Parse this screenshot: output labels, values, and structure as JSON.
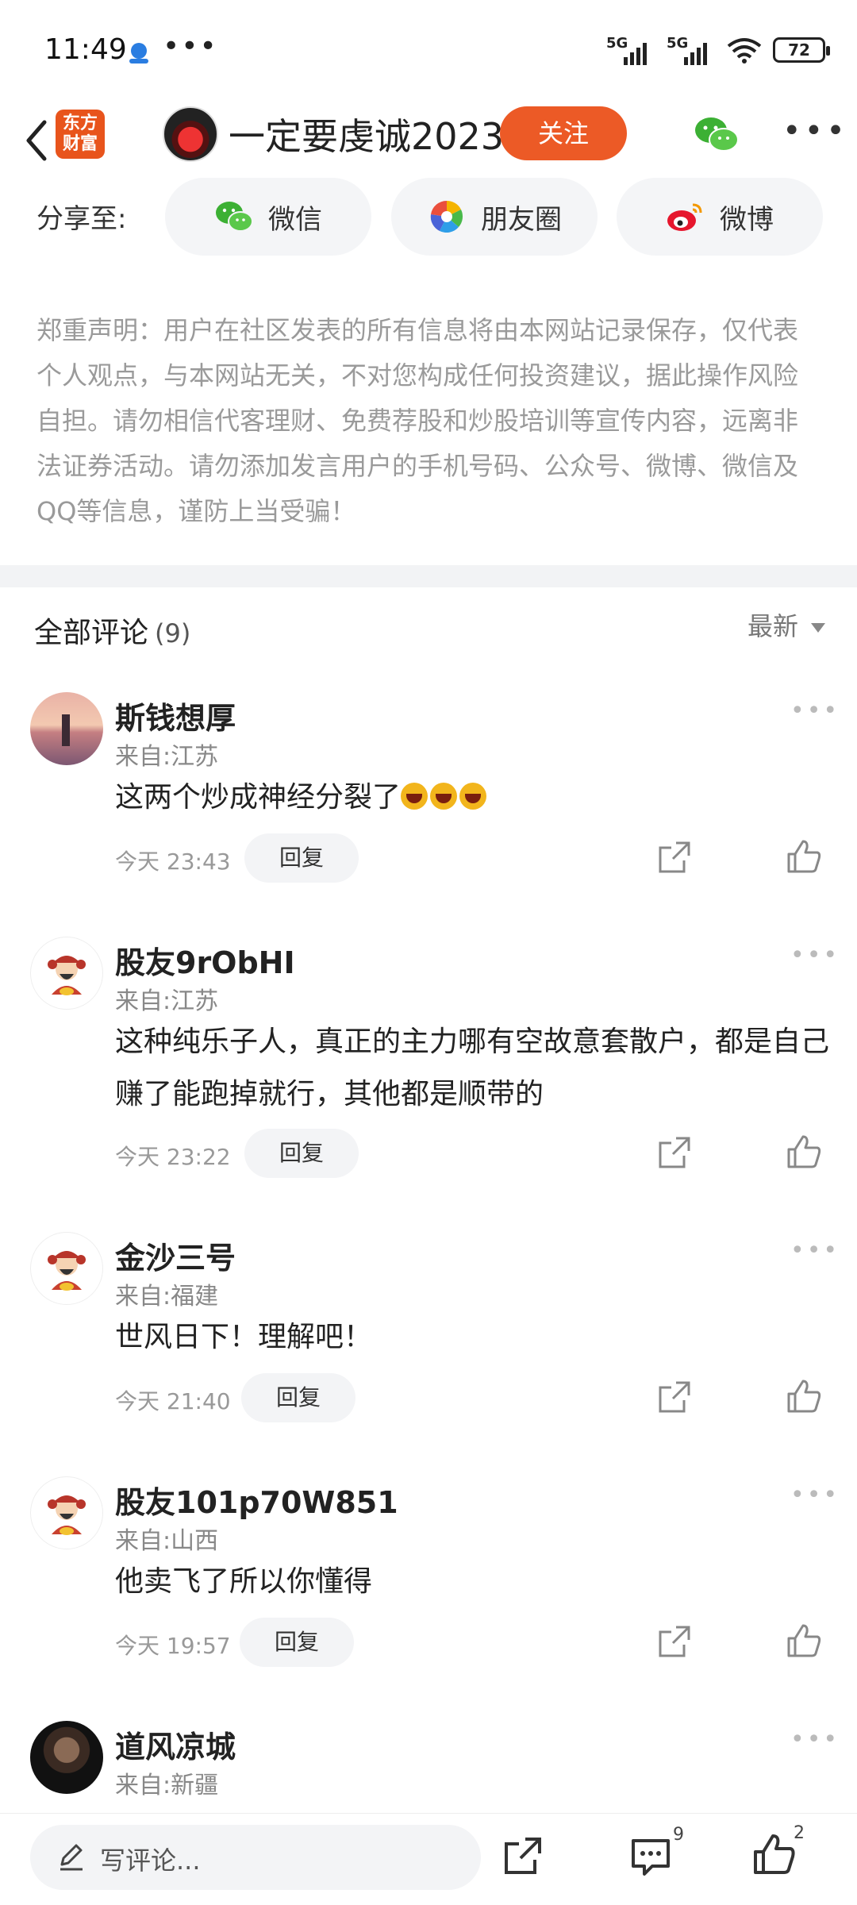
{
  "status_bar": {
    "time": "11:49",
    "more": "•••",
    "network1": "5G",
    "network2": "5G",
    "battery": "72"
  },
  "header": {
    "logo_text_line1": "东方",
    "logo_text_line2": "财富",
    "author": "一定要虔诚2023",
    "follow_label": "关注"
  },
  "share": {
    "label": "分享至:",
    "wechat": "微信",
    "moments": "朋友圈",
    "weibo": "微博"
  },
  "disclaimer": "郑重声明：用户在社区发表的所有信息将由本网站记录保存，仅代表个人观点，与本网站无关，不对您构成任何投资建议，据此操作风险自担。请勿相信代客理财、免费荐股和炒股培训等宣传内容，远离非法证券活动。请勿添加发言用户的手机号码、公众号、微博、微信及QQ等信息，谨防上当受骗！",
  "comments_section": {
    "title": "全部评论",
    "count": "(9)",
    "sort_label": "最新"
  },
  "comments": [
    {
      "name": "斯钱想厚",
      "location": "来自:江苏",
      "text": "这两个炒成神经分裂了",
      "time": "今天 23:43",
      "reply": "回复"
    },
    {
      "name": "股友9rObHI",
      "location": "来自:江苏",
      "text": "这种纯乐子人，真正的主力哪有空故意套散户，都是自己赚了能跑掉就行，其他都是顺带的",
      "time": "今天 23:22",
      "reply": "回复"
    },
    {
      "name": "金沙三号",
      "location": "来自:福建",
      "text": "世风日下！理解吧！",
      "time": "今天 21:40",
      "reply": "回复"
    },
    {
      "name": "股友101p70W851",
      "location": "来自:山西",
      "text": "他卖飞了所以你懂得",
      "time": "今天 19:57",
      "reply": "回复"
    },
    {
      "name": "道风凉城",
      "location": "来自:新疆"
    }
  ],
  "bottom_bar": {
    "placeholder": "写评论...",
    "comment_count": "9",
    "like_count": "2"
  },
  "colors": {
    "accent": "#ec5a26",
    "wechat_green": "#3cb034",
    "weibo_red": "#e6162d"
  }
}
